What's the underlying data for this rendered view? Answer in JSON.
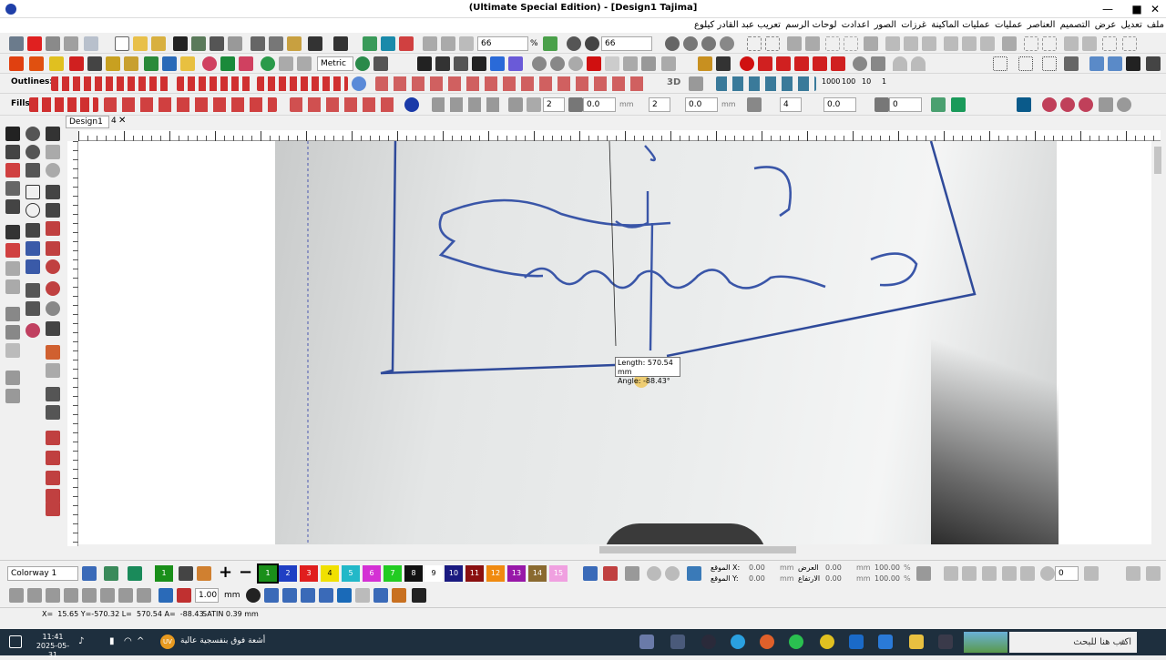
{
  "window": {
    "title": "(Ultimate Special Edition) - [Design1      Tajima]",
    "minimize": "—",
    "maximize": "■",
    "close": "✕"
  },
  "menu": [
    "تعريب عبد القادر كيلوع",
    "لوحات الرسم",
    "اعدادت",
    "الصور",
    "غرزات",
    "عمليات الماكينة",
    "عمليات",
    "العناصر",
    "التصميم",
    "عرض",
    "تعديل",
    "ملف"
  ],
  "toolbar1": {
    "zoom_value": "66",
    "percent": "%",
    "zoom_value2": "66"
  },
  "toolbar2": {
    "units": "Metric"
  },
  "toolbar3": {
    "label": "Outlines:",
    "numbers": [
      "1000",
      "100",
      "10",
      "1"
    ],
    "view3d": "3D"
  },
  "toolbar4": {
    "label": "Fills:",
    "field1": "2",
    "field2": "0.0",
    "unit1": "mm",
    "field3": "2",
    "field4": "0.0",
    "unit2": "mm",
    "field5": "4",
    "field6": "0.0",
    "field7": "0"
  },
  "tabs": {
    "design": "Design1",
    "count": "4",
    "close": "✕"
  },
  "tooltip": {
    "length": "Length: 570.54 mm",
    "angle": "Angle: -88.43°"
  },
  "colorbar": {
    "colorway": "Colorway 1",
    "swatches": [
      {
        "n": "1",
        "c": "#1a8f1a"
      },
      {
        "n": "2",
        "c": "#1f3fc4"
      },
      {
        "n": "3",
        "c": "#e01e1e"
      },
      {
        "n": "4",
        "c": "#f0e000"
      },
      {
        "n": "5",
        "c": "#22b8c8"
      },
      {
        "n": "6",
        "c": "#d430d4"
      },
      {
        "n": "7",
        "c": "#22cc22"
      },
      {
        "n": "8",
        "c": "#111111"
      },
      {
        "n": "9",
        "c": "#ffffff"
      },
      {
        "n": "10",
        "c": "#1a1a80"
      },
      {
        "n": "11",
        "c": "#8a1010"
      },
      {
        "n": "12",
        "c": "#f08a10"
      },
      {
        "n": "13",
        "c": "#9818a8"
      },
      {
        "n": "14",
        "c": "#8a6a30"
      },
      {
        "n": "15",
        "c": "#f0a0e0"
      }
    ],
    "pos_x_label": "الموقع X:",
    "pos_y_label": "الموقع Y:",
    "pos_x": "0.00",
    "pos_y": "0.00",
    "width_label": "العرض",
    "height_label": "الارتفاع",
    "width": "0.00",
    "height": "0.00",
    "unit": "mm",
    "scale_w": "100.00",
    "scale_h": "100.00",
    "pct": "%",
    "rotate": "0"
  },
  "bottom_toolbar": {
    "thickness": "1.00",
    "unit": "mm"
  },
  "status": {
    "coords": "X=  15.65 Y=-570.32 L=  570.54 A=  -88.43",
    "stitch": "SATIN  0.39 mm"
  },
  "taskbar": {
    "time": "11:41",
    "date": "2025-05-31",
    "weather": "أشعة فوق بنفسجية عالية",
    "search": "اكتب هنا للبحث",
    "uv": "UV"
  }
}
